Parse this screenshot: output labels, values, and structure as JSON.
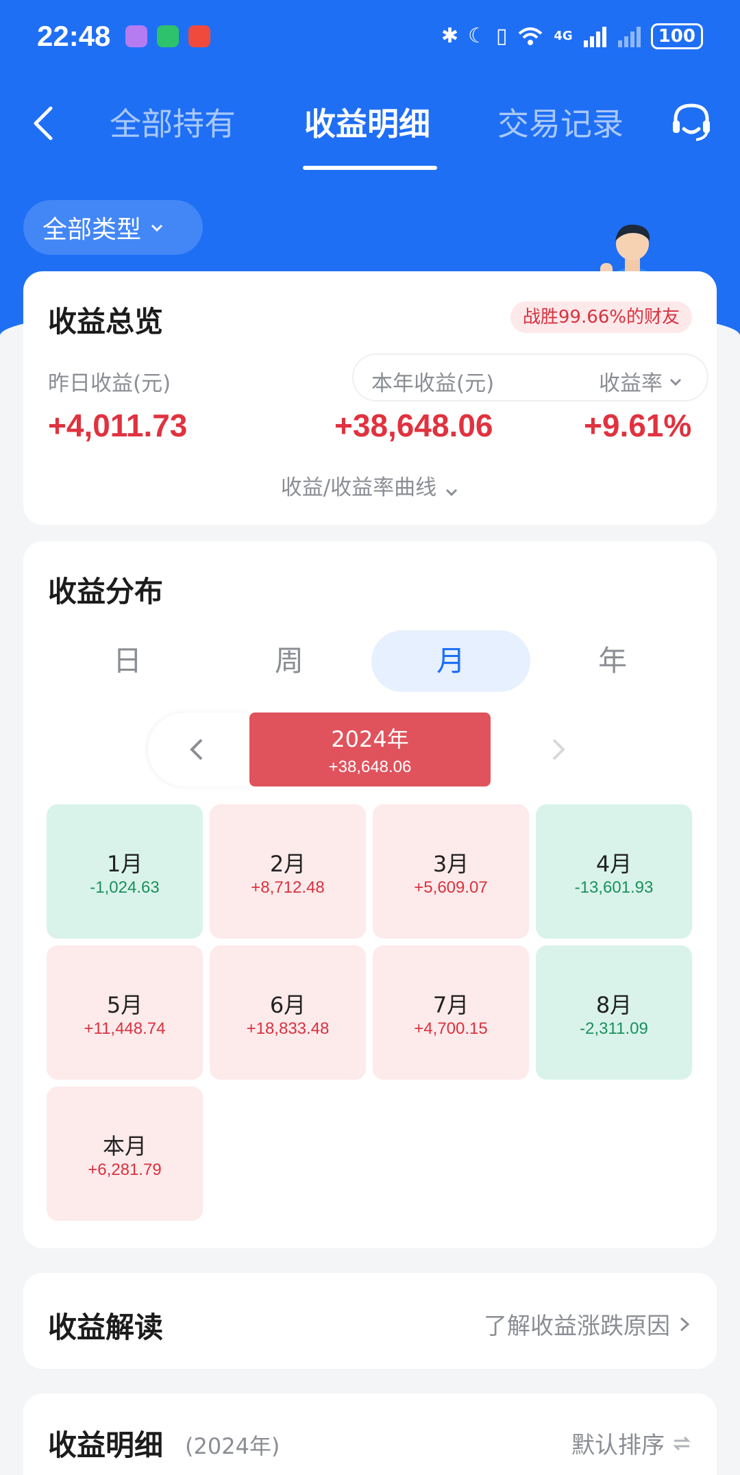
{
  "status_bar": {
    "time": "22:48",
    "battery": "100",
    "network": "4G"
  },
  "nav": {
    "tabs": [
      {
        "label": "全部持有"
      },
      {
        "label": "收益明细"
      },
      {
        "label": "交易记录"
      }
    ],
    "active_tab": "收益明细"
  },
  "filter": {
    "label": "全部类型"
  },
  "overview": {
    "title": "收益总览",
    "rank_badge": "战胜99.66%的财友",
    "yesterday_label": "昨日收益(元)",
    "yesterday_value": "+4,011.73",
    "year_label": "本年收益(元)",
    "year_value": "+38,648.06",
    "rate_label": "收益率",
    "rate_value": "+9.61%",
    "curve_label": "收益/收益率曲线"
  },
  "distribution": {
    "title": "收益分布",
    "segments": [
      {
        "label": "日"
      },
      {
        "label": "周"
      },
      {
        "label": "月"
      },
      {
        "label": "年"
      }
    ],
    "active_segment": "月",
    "year_label": "2024年",
    "year_value": "+38,648.06",
    "months": [
      {
        "name": "1月",
        "value": "-1,024.63",
        "trend": "down"
      },
      {
        "name": "2月",
        "value": "+8,712.48",
        "trend": "up"
      },
      {
        "name": "3月",
        "value": "+5,609.07",
        "trend": "up"
      },
      {
        "name": "4月",
        "value": "-13,601.93",
        "trend": "down"
      },
      {
        "name": "5月",
        "value": "+11,448.74",
        "trend": "up"
      },
      {
        "name": "6月",
        "value": "+18,833.48",
        "trend": "up"
      },
      {
        "name": "7月",
        "value": "+4,700.15",
        "trend": "up"
      },
      {
        "name": "8月",
        "value": "-2,311.09",
        "trend": "down"
      },
      {
        "name": "本月",
        "value": "+6,281.79",
        "trend": "up"
      }
    ]
  },
  "interpretation": {
    "title": "收益解读",
    "link": "了解收益涨跌原因"
  },
  "detail": {
    "title": "收益明细",
    "year": "(2024年)",
    "sort_label": "默认排序"
  },
  "colors": {
    "brand_blue": "#1f6ff5",
    "gain_red": "#e0323f",
    "loss_green": "#1a8f5e"
  }
}
